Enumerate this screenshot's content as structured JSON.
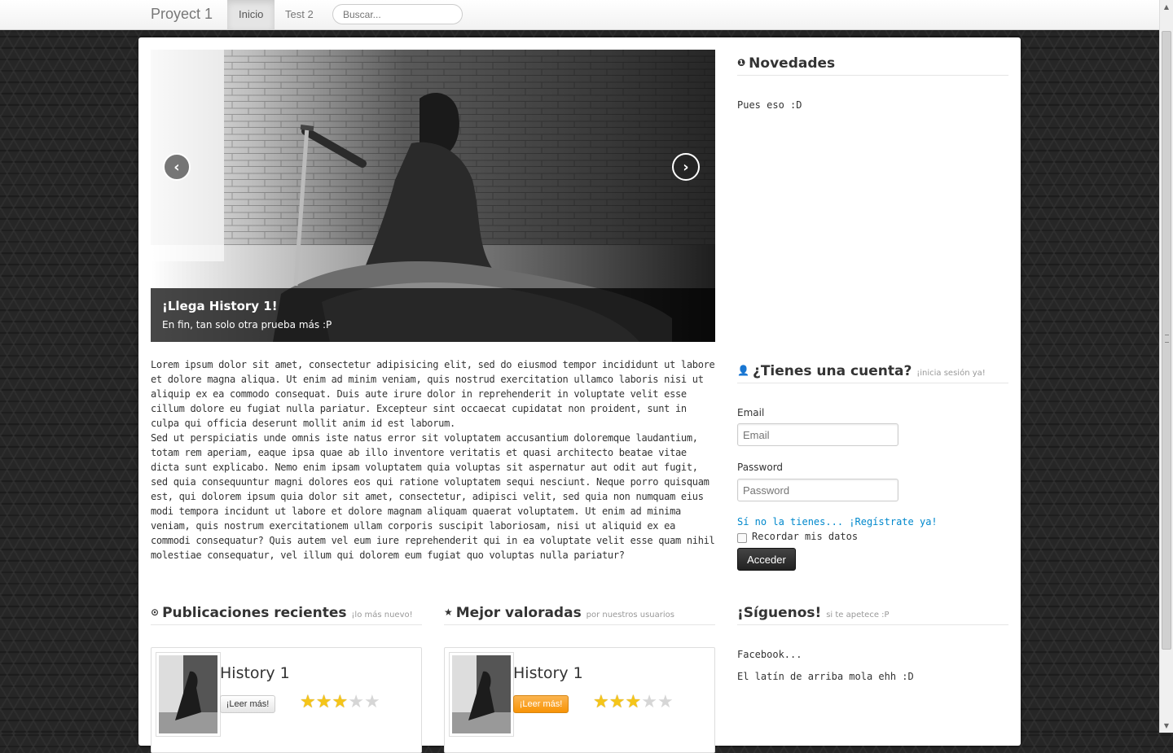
{
  "navbar": {
    "brand": "Proyect 1",
    "tabs": [
      {
        "label": "Inicio",
        "active": true
      },
      {
        "label": "Test 2",
        "active": false
      }
    ],
    "search_placeholder": "Buscar..."
  },
  "carousel": {
    "caption_title": "¡Llega History 1!",
    "caption_text": "En fin, tan solo otra prueba más :P",
    "prev_icon": "chevron-left-icon",
    "next_icon": "chevron-right-icon"
  },
  "main": {
    "paragraphs": [
      "Lorem ipsum dolor sit amet, consectetur adipisicing elit, sed do eiusmod tempor incididunt ut labore et dolore magna aliqua. Ut enim ad minim veniam, quis nostrud exercitation ullamco laboris nisi ut aliquip ex ea commodo consequat. Duis aute irure dolor in reprehenderit in voluptate velit esse cillum dolore eu fugiat nulla pariatur. Excepteur sint occaecat cupidatat non proident, sunt in culpa qui officia deserunt mollit anim id est laborum.",
      "Sed ut perspiciatis unde omnis iste natus error sit voluptatem accusantium doloremque laudantium, totam rem aperiam, eaque ipsa quae ab illo inventore veritatis et quasi architecto beatae vitae dicta sunt explicabo. Nemo enim ipsam voluptatem quia voluptas sit aspernatur aut odit aut fugit, sed quia consequuntur magni dolores eos qui ratione voluptatem sequi nesciunt. Neque porro quisquam est, qui dolorem ipsum quia dolor sit amet, consectetur, adipisci velit, sed quia non numquam eius modi tempora incidunt ut labore et dolore magnam aliquam quaerat voluptatem. Ut enim ad minima veniam, quis nostrum exercitationem ullam corporis suscipit laboriosam, nisi ut aliquid ex ea commodi consequatur? Quis autem vel eum iure reprehenderit qui in ea voluptate velit esse quam nihil molestiae consequatur, vel illum qui dolorem eum fugiat quo voluptas nulla pariatur?"
    ]
  },
  "news": {
    "title": "Novedades",
    "icon": "info-icon",
    "text": "Pues eso :D"
  },
  "login": {
    "title": "¿Tienes una cuenta?",
    "subtitle": "¡inicia sesión ya!",
    "icon": "user-icon",
    "email_label": "Email",
    "email_placeholder": "Email",
    "password_label": "Password",
    "password_placeholder": "Password",
    "register_link": "Sí no la tienes... ¡Regístrate ya!",
    "remember_label": "Recordar mis datos",
    "remember_checked": false,
    "submit_label": "Acceder"
  },
  "recent": {
    "title": "Publicaciones recientes",
    "subtitle": "¡lo más nuevo!",
    "icon": "clock-icon",
    "card": {
      "title": "History 1",
      "button": "¡Leer más!",
      "rating": 3,
      "max_rating": 5
    }
  },
  "top_rated": {
    "title": "Mejor valoradas",
    "subtitle": "por nuestros usuarios",
    "icon": "star-icon",
    "card": {
      "title": "History 1",
      "button": "¡Leer más!",
      "rating": 3,
      "max_rating": 5
    }
  },
  "follow": {
    "title": "¡Síguenos!",
    "subtitle": "si te apetece :P",
    "lines": [
      "Facebook...",
      "El latín de arriba mola ehh :D"
    ]
  },
  "colors": {
    "link": "#0088cc",
    "accent_orange": "#f89406",
    "dark_button": "#222222",
    "star_on": "#f5c518"
  }
}
